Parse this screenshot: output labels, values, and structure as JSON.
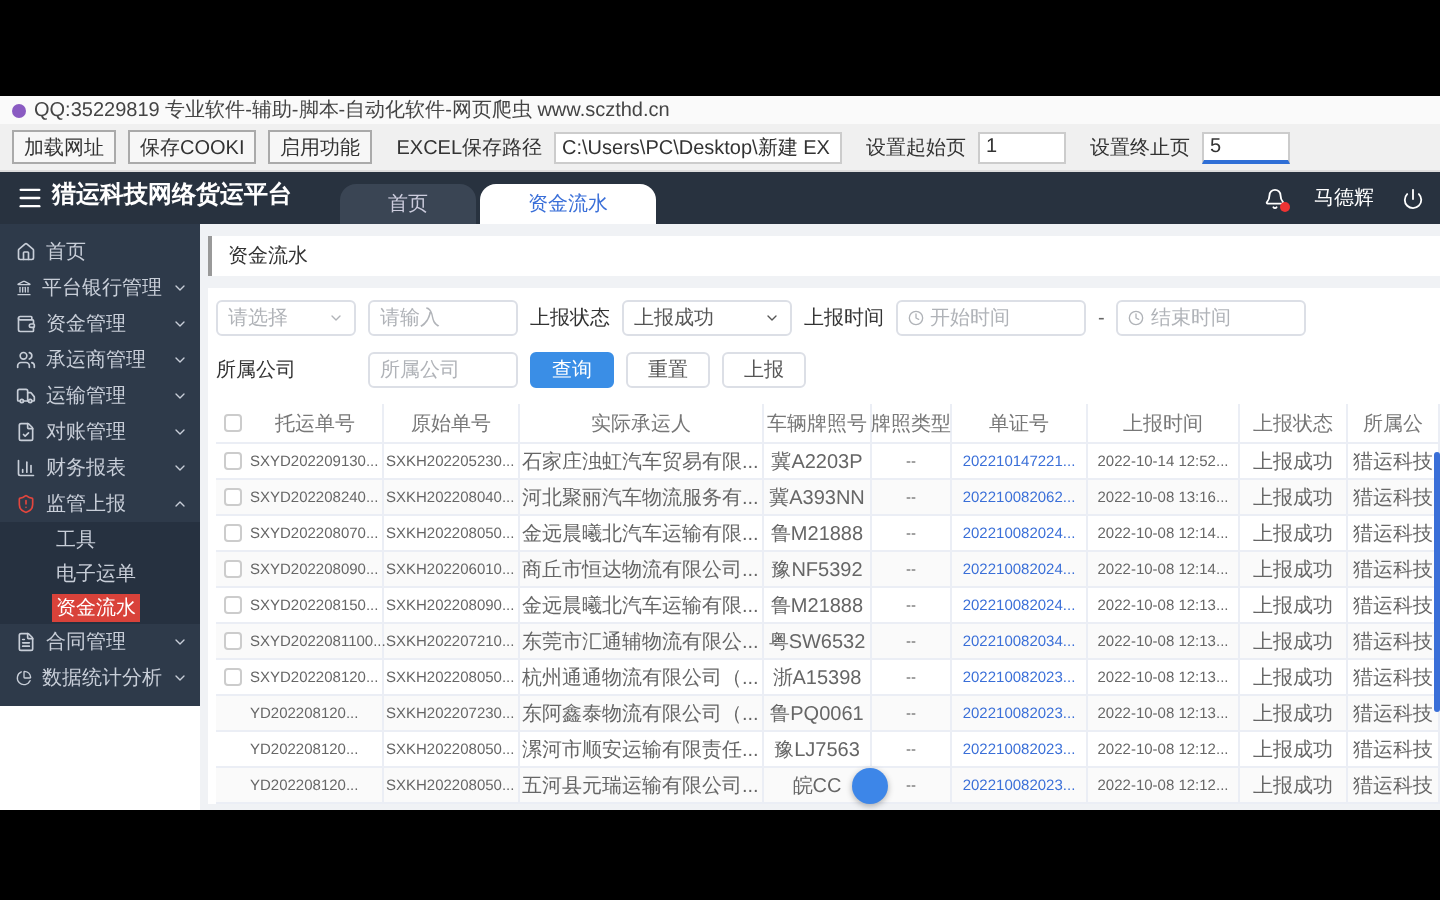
{
  "window": {
    "title": "QQ:35229819 专业软件-辅助-脚本-自动化软件-网页爬虫 www.sczthd.cn"
  },
  "toolbar": {
    "buttons": [
      "加载网址",
      "保存COOKI",
      "启用功能"
    ],
    "fields": [
      {
        "label": "EXCEL保存路径",
        "value": "C:\\Users\\PC\\Desktop\\新建 EX",
        "focused": false
      },
      {
        "label": "设置起始页",
        "value": "1",
        "focused": false
      },
      {
        "label": "设置终止页",
        "value": "5",
        "focused": true
      }
    ]
  },
  "header": {
    "title": "猎运科技网络货运平台",
    "user": "马德辉",
    "has_notification": true
  },
  "tabs": [
    {
      "label": "首页",
      "selected": false
    },
    {
      "label": "资金流水",
      "selected": true
    }
  ],
  "sidebar": {
    "items": [
      {
        "label": "首页"
      },
      {
        "label": "平台银行管理",
        "expanded": false
      },
      {
        "label": "资金管理",
        "expanded": false
      },
      {
        "label": "承运商管理",
        "expanded": false
      },
      {
        "label": "运输管理",
        "expanded": false
      },
      {
        "label": "对账管理",
        "expanded": false
      },
      {
        "label": "财务报表",
        "expanded": false
      },
      {
        "label": "监管上报",
        "expanded": true,
        "children": [
          {
            "label": "工具",
            "selected": false
          },
          {
            "label": "电子运单",
            "selected": false
          },
          {
            "label": "资金流水",
            "selected": true
          }
        ]
      },
      {
        "label": "合同管理",
        "expanded": false
      },
      {
        "label": "数据统计分析",
        "expanded": false
      }
    ]
  },
  "breadcrumb": "资金流水",
  "filters": {
    "select_placeholder": "请选择",
    "input_placeholder": "请输入",
    "status_label": "上报状态",
    "status_value": "上报成功",
    "time_label": "上报时间",
    "start_placeholder": "开始时间",
    "range_separator": "-",
    "end_placeholder": "结束时间",
    "company_label": "所属公司",
    "company_placeholder": "所属公司"
  },
  "actions": [
    {
      "label": "查询",
      "kind": "primary"
    },
    {
      "label": "重置",
      "kind": "plain"
    },
    {
      "label": "上报",
      "kind": "plain"
    }
  ],
  "table": {
    "all_checked": false,
    "columns": [
      "托运单号",
      "原始单号",
      "实际承运人",
      "车辆牌照号",
      "牌照类型",
      "单证号",
      "上报时间",
      "上报状态",
      "所属公"
    ],
    "rows": [
      {
        "checked": false,
        "cells": [
          "SXYD202209130...",
          "SXKH202205230...",
          "石家庄浊虹汽车贸易有限...",
          "冀A2203P",
          "--",
          "202210147221...",
          "2022-10-14 12:52...",
          "上报成功",
          "猎运科技"
        ]
      },
      {
        "checked": false,
        "cells": [
          "SXYD202208240...",
          "SXKH202208040...",
          "河北聚丽汽车物流服务有...",
          "冀A393NN",
          "--",
          "202210082062...",
          "2022-10-08 13:16...",
          "上报成功",
          "猎运科技"
        ]
      },
      {
        "checked": false,
        "cells": [
          "SXYD202208070...",
          "SXKH202208050...",
          "金远晨曦北汽车运输有限...",
          "鲁M21888",
          "--",
          "202210082024...",
          "2022-10-08 12:14...",
          "上报成功",
          "猎运科技"
        ]
      },
      {
        "checked": false,
        "cells": [
          "SXYD202208090...",
          "SXKH202206010...",
          "商丘市恒达物流有限公司...",
          "豫NF5392",
          "--",
          "202210082024...",
          "2022-10-08 12:14...",
          "上报成功",
          "猎运科技"
        ]
      },
      {
        "checked": false,
        "cells": [
          "SXYD202208150...",
          "SXKH202208090...",
          "金远晨曦北汽车运输有限...",
          "鲁M21888",
          "--",
          "202210082024...",
          "2022-10-08 12:13...",
          "上报成功",
          "猎运科技"
        ]
      },
      {
        "checked": false,
        "cells": [
          "SXYD2022081100...",
          "SXKH202207210...",
          "东莞市汇通辅物流有限公...",
          "粤SW6532",
          "--",
          "202210082034...",
          "2022-10-08 12:13...",
          "上报成功",
          "猎运科技"
        ]
      },
      {
        "checked": false,
        "cells": [
          "SXYD202208120...",
          "SXKH202208050...",
          "杭州通通物流有限公司（...",
          "浙A15398",
          "--",
          "202210082023...",
          "2022-10-08 12:13...",
          "上报成功",
          "猎运科技"
        ]
      },
      {
        "cells": [
          "YD202208120...",
          "SXKH202207230...",
          "东阿鑫泰物流有限公司（...",
          "鲁PQ0061",
          "--",
          "202210082023...",
          "2022-10-08 12:13...",
          "上报成功",
          "猎运科技"
        ]
      },
      {
        "cells": [
          "YD202208120...",
          "SXKH202208050...",
          "漯河市顺安运输有限责任...",
          "豫LJ7563",
          "--",
          "202210082023...",
          "2022-10-08 12:12...",
          "上报成功",
          "猎运科技"
        ]
      },
      {
        "cells": [
          "YD202208120...",
          "SXKH202208050...",
          "五河县元瑞运输有限公司...",
          "皖CC",
          "--",
          "202210082023...",
          "2022-10-08 12:12...",
          "上报成功",
          "猎运科技"
        ]
      }
    ]
  }
}
